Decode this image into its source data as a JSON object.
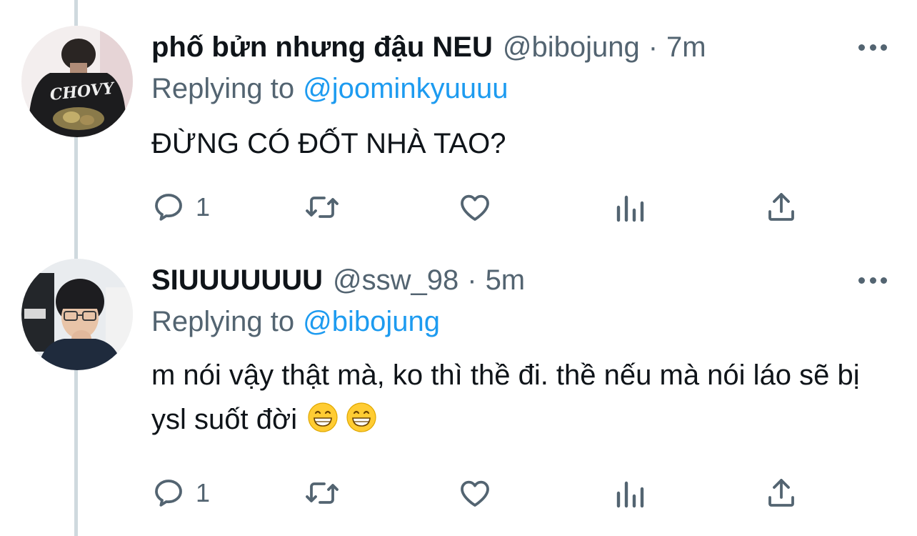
{
  "colors": {
    "text": "#0f1419",
    "secondary": "#536471",
    "link": "#1d9bf0",
    "thread_line": "#cfd9de"
  },
  "tweets": [
    {
      "display_name": "phố bửn nhưng đậu NEU",
      "handle": "@bibojung",
      "separator": "·",
      "time": "7m",
      "replying_prefix": "Replying to",
      "replying_to": "@joominkyuuuu",
      "text": "ĐỪNG CÓ ĐỐT NHÀ TAO?",
      "reply_count": "1",
      "avatar_text": "CHOVY"
    },
    {
      "display_name": "SIUUUUUUU",
      "handle": "@ssw_98",
      "separator": "·",
      "time": "5m",
      "replying_prefix": "Replying to",
      "replying_to": "@bibojung",
      "text": "m nói vậy thật mà, ko thì thề đi. thề nếu mà nói láo sẽ bị ysl suốt đời",
      "emojis": [
        "grinning-face-icon",
        "grinning-face-icon"
      ],
      "reply_count": "1"
    }
  ],
  "icons": {
    "reply": "reply-icon",
    "retweet": "retweet-icon",
    "like": "heart-icon",
    "views": "analytics-icon",
    "share": "share-icon",
    "more": "more-dots-icon"
  }
}
